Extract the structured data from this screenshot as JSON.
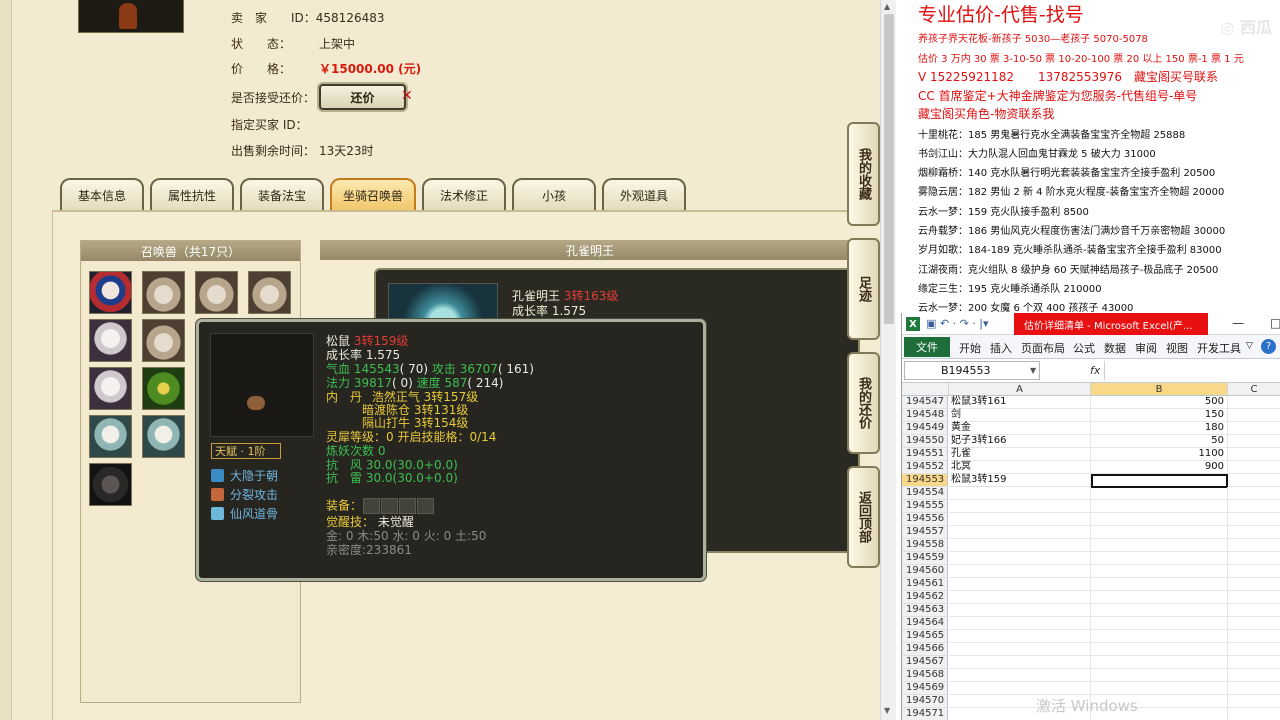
{
  "listing": {
    "seller_label": "卖　家",
    "seller_value": "ID：458126483",
    "status_label": "状　　态：",
    "status_value": "上架中",
    "price_label": "价　　格：",
    "price_value": "￥15000.00 (元)",
    "accept_label": "是否接受还价：",
    "haggle_button": "还价",
    "buyer_label": "指定买家 ID：",
    "remain_label": "出售剩余时间：",
    "remain_value": "13天23时"
  },
  "tabs": [
    {
      "label": "基本信息"
    },
    {
      "label": "属性抗性"
    },
    {
      "label": "装备法宝"
    },
    {
      "label": "坐骑召唤兽"
    },
    {
      "label": "法术修正"
    },
    {
      "label": "小孩"
    },
    {
      "label": "外观道具"
    }
  ],
  "pets": {
    "header": "召唤兽（共17只）"
  },
  "detail": {
    "header": "孔雀明王",
    "pet_name": "孔雀明王",
    "pet_level": "3转163级",
    "growth": "成长率 1.575"
  },
  "tooltip": {
    "name": "松鼠",
    "level": "3转159级",
    "growth": "成长率 1.575",
    "stats1_a": "气血 145543",
    "stats1_b": "( 70)",
    "stats1_c": " 攻击 36707",
    "stats1_d": "( 161)",
    "stats2_a": "法力 39817",
    "stats2_b": "( 0)",
    "stats2_c": " 速度 587",
    "stats2_d": "( 214)",
    "neidan_label": "内　丹",
    "neidan1": "浩然正气 3转157级",
    "neidan2": "暗渡陈仓 3转131级",
    "neidan3": "隔山打牛 3转154级",
    "lingxi": "灵犀等级：0 开启技能格：0/14",
    "lianyao": "炼妖次数 0",
    "resist_wind": "抗　风 30.0(30.0+0.0)",
    "resist_thunder": "抗　雷 30.0(30.0+0.0)",
    "equip_label": "装备：",
    "awaken_label": "觉醒技：",
    "awaken_value": "未觉醒",
    "elements": "金: 0 木:50 水: 0 火: 0 土:50",
    "intimacy": "亲密度:233861",
    "talent": "天赋 · 1阶",
    "skills": [
      "大隐于朝",
      "分裂攻击",
      "仙风道骨"
    ]
  },
  "side_buttons": [
    "我的收藏",
    "足迹",
    "我的还价",
    "返回顶部"
  ],
  "notes": [
    {
      "text": "专业估价-代售-找号",
      "color": "#e01010",
      "size": 19
    },
    {
      "text": "养孩子界天花板-新孩子 5030—老孩子 5070-5078",
      "color": "#e01010",
      "size": 10
    },
    {
      "text": "估价 3 万内 30 票 3-10-50 票 10-20-100 票 20 以上 150 票-1 票 1 元",
      "color": "#e01010",
      "size": 10
    },
    {
      "text": "V 15225921182　　13782553976　藏宝阁买号联系",
      "color": "#e01010",
      "size": 12
    },
    {
      "text": "CC 首席鉴定+大神金牌鉴定为您服务-代售组号-单号",
      "color": "#e01010",
      "size": 12
    },
    {
      "text": "藏宝阁买角色-物资联系我",
      "color": "#e01010",
      "size": 12
    },
    {
      "text": "十里桃花：185 男鬼暑行克水全满装备宝宝齐全物超 25888",
      "color": "#111111",
      "size": 10
    },
    {
      "text": "书剑江山：大力队混人回血鬼甘霖龙 5 破大力 31000",
      "color": "#111111",
      "size": 10
    },
    {
      "text": "烟柳霜桥：140 克水队暑行明光套装装备宝宝齐全接手盈利 20500",
      "color": "#111111",
      "size": 10
    },
    {
      "text": "雾隐云居：182 男仙 2 新 4 阶水克火程度-装备宝宝齐全物超 20000",
      "color": "#111111",
      "size": 10
    },
    {
      "text": "云水一梦：159 克火队接手盈利 8500",
      "color": "#111111",
      "size": 10
    },
    {
      "text": "云舟载梦：186 男仙风克火程度伤害法门满炒音千万亲密物超 30000",
      "color": "#111111",
      "size": 10
    },
    {
      "text": "岁月如歌：184-189 克火睡杀队通杀-装备宝宝齐全接手盈利 83000",
      "color": "#111111",
      "size": 10
    },
    {
      "text": "江湖夜雨：克火组队 8 级护身 60 天赋神结局孩子-极品底子 20500",
      "color": "#111111",
      "size": 10
    },
    {
      "text": "缘定三生：195 克火睡杀通杀队 210000",
      "color": "#111111",
      "size": 10
    },
    {
      "text": "云水一梦：200 女魔 6 个双 400 孩孩子 43000",
      "color": "#111111",
      "size": 10
    }
  ],
  "excel": {
    "title": "估价详细清单 - Microsoft Excel(产...",
    "menus": [
      "开始",
      "插入",
      "页面布局",
      "公式",
      "数据",
      "审阅",
      "视图",
      "开发工具"
    ],
    "file_tab": "文件",
    "name_box": "B194553",
    "fx": "fx",
    "col_a": "A",
    "col_b": "B",
    "col_c": "C",
    "rows": [
      {
        "num": "194547",
        "a": "松鼠3转161",
        "b": "500"
      },
      {
        "num": "194548",
        "a": "剑",
        "b": "150"
      },
      {
        "num": "194549",
        "a": "黄金",
        "b": "180"
      },
      {
        "num": "194550",
        "a": "妃子3转166",
        "b": "50"
      },
      {
        "num": "194551",
        "a": "孔雀",
        "b": "1100"
      },
      {
        "num": "194552",
        "a": "北冥",
        "b": "900"
      },
      {
        "num": "194553",
        "a": "松鼠3转159",
        "b": ""
      },
      {
        "num": "194554",
        "a": "",
        "b": ""
      },
      {
        "num": "194555",
        "a": "",
        "b": ""
      },
      {
        "num": "194556",
        "a": "",
        "b": ""
      },
      {
        "num": "194557",
        "a": "",
        "b": ""
      },
      {
        "num": "194558",
        "a": "",
        "b": ""
      },
      {
        "num": "194559",
        "a": "",
        "b": ""
      },
      {
        "num": "194560",
        "a": "",
        "b": ""
      },
      {
        "num": "194561",
        "a": "",
        "b": ""
      },
      {
        "num": "194562",
        "a": "",
        "b": ""
      },
      {
        "num": "194563",
        "a": "",
        "b": ""
      },
      {
        "num": "194564",
        "a": "",
        "b": ""
      },
      {
        "num": "194565",
        "a": "",
        "b": ""
      },
      {
        "num": "194566",
        "a": "",
        "b": ""
      },
      {
        "num": "194567",
        "a": "",
        "b": ""
      },
      {
        "num": "194568",
        "a": "",
        "b": ""
      },
      {
        "num": "194569",
        "a": "",
        "b": ""
      },
      {
        "num": "194570",
        "a": "",
        "b": ""
      },
      {
        "num": "194571",
        "a": "",
        "b": ""
      }
    ]
  },
  "windows_watermark": "激活 Windows",
  "top_watermark": "◎ 西瓜"
}
